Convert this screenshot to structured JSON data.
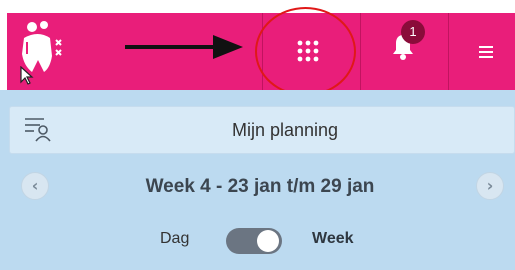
{
  "header": {
    "logo_icon": "people-group-logo-icon",
    "apps_icon": "grid-apps-icon",
    "notifications_icon": "bell-icon",
    "notification_count": "1",
    "menu_icon": "hamburger-menu-icon",
    "annotation_arrow": "black-arrow-pointing-right",
    "annotation_circle_color": "#e01818",
    "brand_color": "#e91e7a"
  },
  "planning": {
    "icon": "filter-person-icon",
    "title": "Mijn planning"
  },
  "week_nav": {
    "prev_icon": "chevron-left-icon",
    "next_icon": "chevron-right-icon",
    "title": "Week 4 - 23 jan t/m 29 jan"
  },
  "view_toggle": {
    "left_label": "Dag",
    "right_label": "Week",
    "selected": "Week"
  }
}
